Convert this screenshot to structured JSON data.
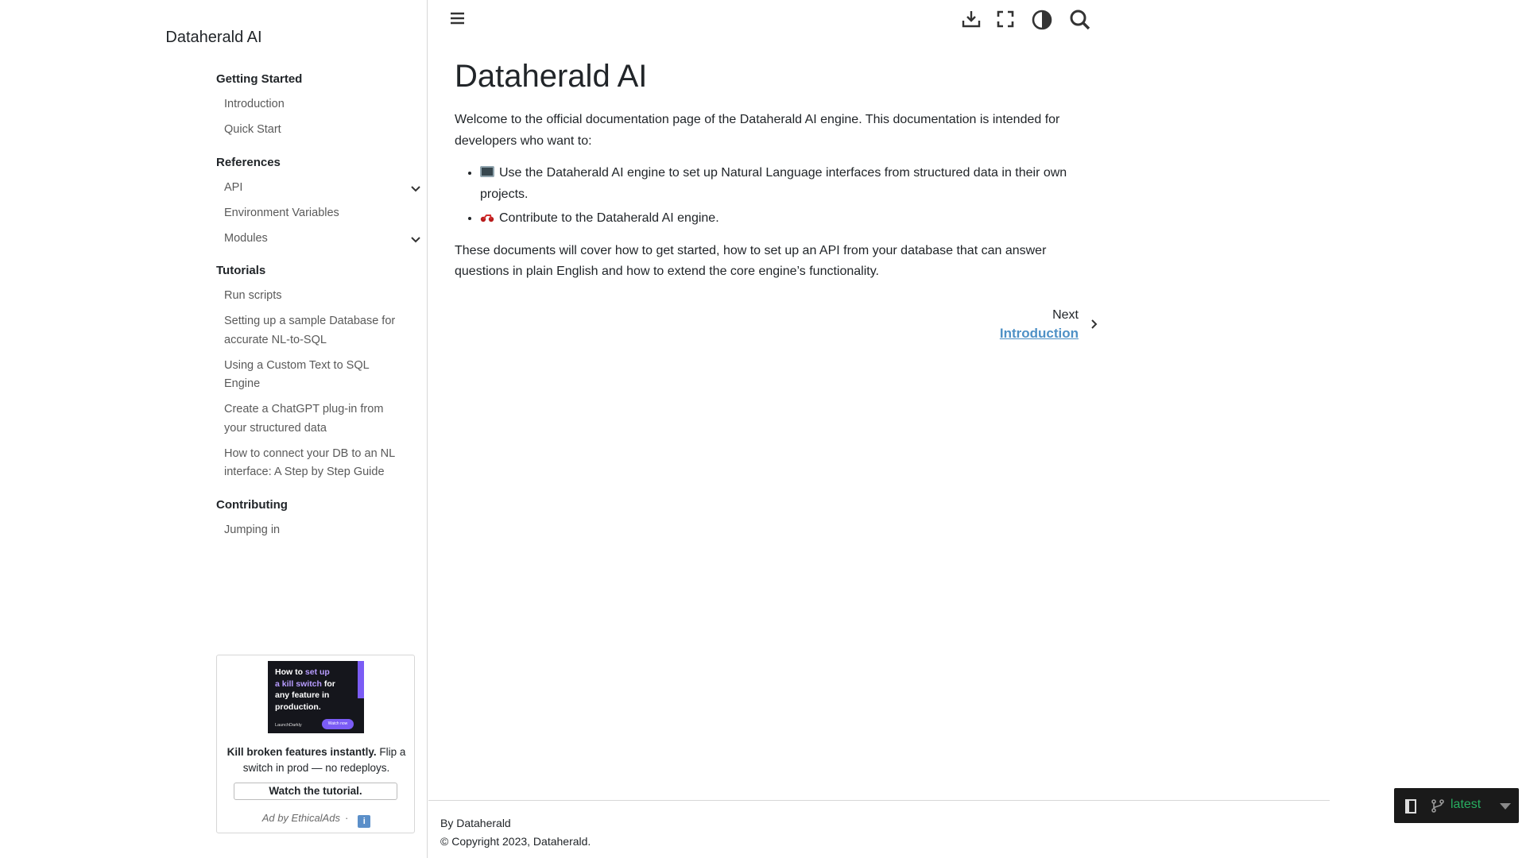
{
  "sidebar": {
    "brand": "Dataherald AI",
    "sections": [
      {
        "title": "Getting Started",
        "items": [
          {
            "label": "Introduction",
            "expandable": false
          },
          {
            "label": "Quick Start",
            "expandable": false
          }
        ]
      },
      {
        "title": "References",
        "items": [
          {
            "label": "API",
            "expandable": true
          },
          {
            "label": "Environment Variables",
            "expandable": false
          },
          {
            "label": "Modules",
            "expandable": true
          }
        ]
      },
      {
        "title": "Tutorials",
        "items": [
          {
            "label": "Run scripts",
            "expandable": false
          },
          {
            "label": "Setting up a sample Database for accurate NL-to-SQL",
            "expandable": false
          },
          {
            "label": "Using a Custom Text to SQL Engine",
            "expandable": false
          },
          {
            "label": "Create a ChatGPT plug-in from your structured data",
            "expandable": false
          },
          {
            "label": "How to connect your DB to an NL interface: A Step by Step Guide",
            "expandable": false
          }
        ]
      },
      {
        "title": "Contributing",
        "items": [
          {
            "label": "Jumping in",
            "expandable": false
          }
        ]
      }
    ]
  },
  "ad": {
    "image_line1": "How to ",
    "image_line1_hl": "set up",
    "image_line2_hl": "a kill switch",
    "image_line2": " for",
    "image_line3": "any feature in",
    "image_line4": "production.",
    "image_logo": "LaunchDarkly",
    "image_cta": "Watch now",
    "text_bold": "Kill broken features instantly.",
    "text_rest": " Flip a switch in prod — no redeploys.",
    "button": "Watch the tutorial.",
    "attribution": "Ad by EthicalAds",
    "separator": "·",
    "info_icon": "i"
  },
  "toolbar": {
    "icons": [
      "menu-icon",
      "download-icon",
      "fullscreen-icon",
      "theme-toggle-icon",
      "search-icon"
    ]
  },
  "article": {
    "title": "Dataherald AI",
    "intro": "Welcome to the official documentation page of the Dataherald AI engine. This documentation is intended for developers who want to:",
    "bullets": [
      "Use the Dataherald AI engine to set up Natural Language interfaces from structured data in their own projects.",
      "Contribute to the Dataherald AI engine."
    ],
    "outro": "These documents will cover how to get started, how to set up an API from your database that can answer questions in plain English and how to extend the core engine’s functionality."
  },
  "pagination": {
    "next_label": "Next",
    "next_title": "Introduction"
  },
  "footer": {
    "by": "By Dataherald",
    "copyright": "© Copyright 2023, Dataherald."
  },
  "rtd_badge": {
    "version": "latest"
  },
  "colors": {
    "link": "#4f91c6",
    "rtd_version": "#27ae60",
    "ad_accent": "#7b5cf5"
  }
}
